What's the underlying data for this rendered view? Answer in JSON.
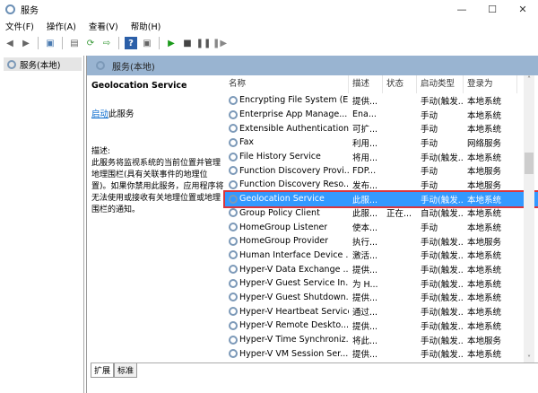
{
  "window": {
    "title": "服务",
    "minimize": "—",
    "maximize": "☐",
    "close": "✕"
  },
  "menu": [
    "文件(F)",
    "操作(A)",
    "查看(V)",
    "帮助(H)"
  ],
  "tree": {
    "item": "服务(本地)"
  },
  "main": {
    "header": "服务(本地)",
    "detail": {
      "service_name": "Geolocation Service",
      "start_link": "启动",
      "start_suffix": "此服务",
      "desc_label": "描述:",
      "description": "此服务将监视系统的当前位置并管理地理围栏(具有关联事件的地理位置)。如果你禁用此服务，应用程序将无法使用或接收有关地理位置或地理围栏的通知。"
    },
    "columns": [
      "名称",
      "描述",
      "状态",
      "启动类型",
      "登录为"
    ],
    "rows": [
      [
        "Encrypting File System (E...",
        "提供...",
        "",
        "手动(触发...",
        "本地系统"
      ],
      [
        "Enterprise App Manage...",
        "Ena...",
        "",
        "手动",
        "本地系统"
      ],
      [
        "Extensible Authentication...",
        "可扩...",
        "",
        "手动",
        "本地系统"
      ],
      [
        "Fax",
        "利用...",
        "",
        "手动",
        "网络服务"
      ],
      [
        "File History Service",
        "将用...",
        "",
        "手动(触发...",
        "本地系统"
      ],
      [
        "Function Discovery Provi...",
        "FDP...",
        "",
        "手动",
        "本地服务"
      ],
      [
        "Function Discovery Reso...",
        "发布...",
        "",
        "手动",
        "本地服务"
      ],
      [
        "Geolocation Service",
        "此服...",
        "",
        "手动(触发...",
        "本地系统"
      ],
      [
        "Group Policy Client",
        "此服...",
        "正在...",
        "自动(触发...",
        "本地系统"
      ],
      [
        "HomeGroup Listener",
        "使本...",
        "",
        "手动",
        "本地系统"
      ],
      [
        "HomeGroup Provider",
        "执行...",
        "",
        "手动(触发...",
        "本地服务"
      ],
      [
        "Human Interface Device ...",
        "激活...",
        "",
        "手动(触发...",
        "本地系统"
      ],
      [
        "Hyper-V Data Exchange ...",
        "提供...",
        "",
        "手动(触发...",
        "本地系统"
      ],
      [
        "Hyper-V Guest Service In...",
        "为 H...",
        "",
        "手动(触发...",
        "本地系统"
      ],
      [
        "Hyper-V Guest Shutdown...",
        "提供...",
        "",
        "手动(触发...",
        "本地系统"
      ],
      [
        "Hyper-V Heartbeat Service",
        "通过...",
        "",
        "手动(触发...",
        "本地系统"
      ],
      [
        "Hyper-V Remote Deskto...",
        "提供...",
        "",
        "手动(触发...",
        "本地系统"
      ],
      [
        "Hyper-V Time Synchroniz...",
        "将此...",
        "",
        "手动(触发...",
        "本地服务"
      ],
      [
        "Hyper-V VM Session Ser...",
        "提供...",
        "",
        "手动(触发...",
        "本地系统"
      ]
    ],
    "selected_index": 7,
    "tabs": [
      "扩展",
      "标准"
    ]
  },
  "colors": {
    "header": "#99b4d1",
    "selection": "#3399ff",
    "highlight_border": "#d9363e"
  }
}
